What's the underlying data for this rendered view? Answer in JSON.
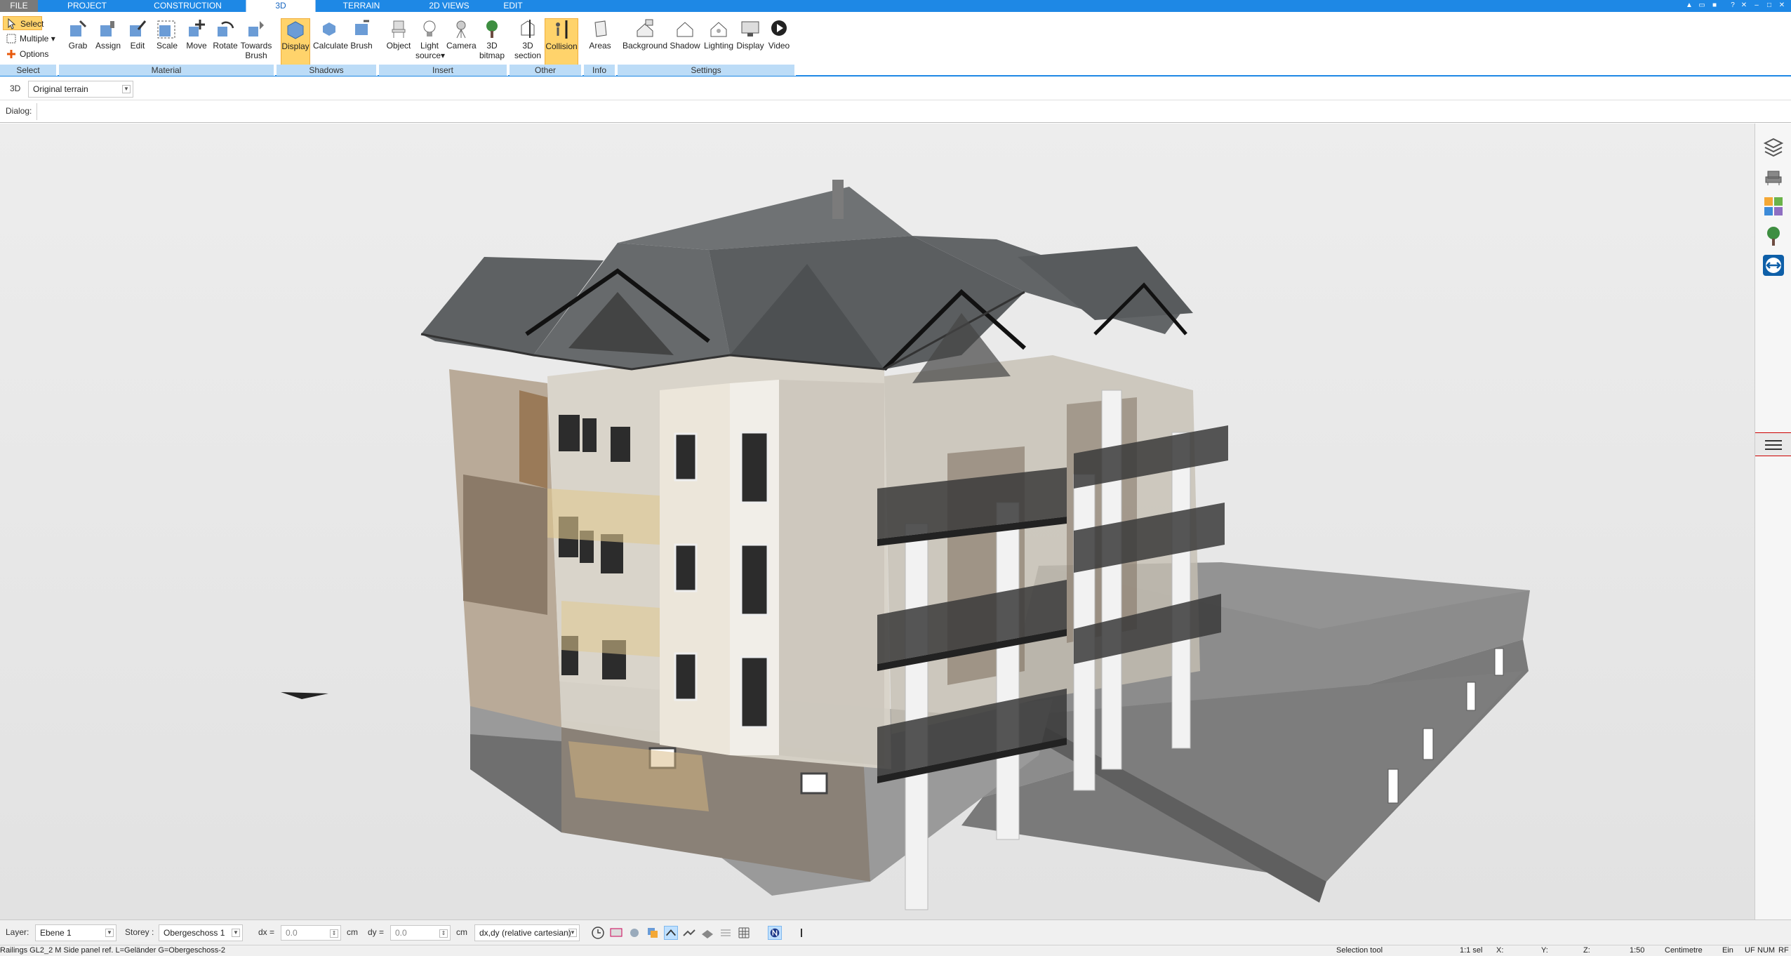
{
  "menu_tabs": [
    {
      "label": "FILE"
    },
    {
      "label": "PROJECT"
    },
    {
      "label": "CONSTRUCTION"
    },
    {
      "label": "3D"
    },
    {
      "label": "TERRAIN"
    },
    {
      "label": "2D VIEWS"
    },
    {
      "label": "EDIT"
    }
  ],
  "select_group": {
    "select": "Select",
    "multiple": "Multiple",
    "options": "Options",
    "group_label": "Select"
  },
  "material_group": {
    "buttons": [
      "Grab",
      "Assign",
      "Edit",
      "Scale",
      "Move",
      "Rotate",
      "Towards",
      "Brush"
    ],
    "group_label": "Material"
  },
  "shadows_group": {
    "buttons": [
      "Display",
      "Calculate",
      "Brush"
    ],
    "group_label": "Shadows"
  },
  "insert_group": {
    "object": "Object",
    "light1": "Light",
    "light2": "source",
    "camera": "Camera",
    "bitmap1": "3D",
    "bitmap2": "bitmap",
    "group_label": "Insert"
  },
  "other_group": {
    "section1": "3D",
    "section2": "section",
    "collision": "Collision",
    "group_label": "Other"
  },
  "info_group": {
    "areas": "Areas",
    "group_label": "Info"
  },
  "settings_group": {
    "buttons": [
      "Background",
      "Shadow",
      "Lighting",
      "Display",
      "Video"
    ],
    "group_label": "Settings"
  },
  "view_row": {
    "mode": "3D",
    "terrain_value": "Original terrain"
  },
  "dialog_row": {
    "label": "Dialog:"
  },
  "bottom": {
    "layer_label": "Layer:",
    "layer_value": "Ebene 1",
    "storey_label": "Storey :",
    "storey_value": "Obergeschoss 1",
    "dx_label": "dx =",
    "dx_value": "0.0",
    "dx_unit": "cm",
    "dy_label": "dy =",
    "dy_value": "0.0",
    "dy_unit": "cm",
    "coord_mode": "dx,dy (relative cartesian)"
  },
  "status": {
    "message": "Railings GL2_2 M Side panel ref. L=Geländer G=Obergeschoss-2",
    "tool": "Selection tool",
    "sel": "1:1 sel",
    "x": "X:",
    "y": "Y:",
    "z": "Z:",
    "scale": "1:50",
    "unit": "Centimetre",
    "ein": "Ein",
    "uf": "UF",
    "num": "NUM",
    "rf": "RF"
  },
  "colors": {
    "accent": "#1e88e5",
    "active_button": "#ffd36b",
    "group_label_bg": "#bcdcf7",
    "viewport_bg": "#e9e9e9"
  }
}
